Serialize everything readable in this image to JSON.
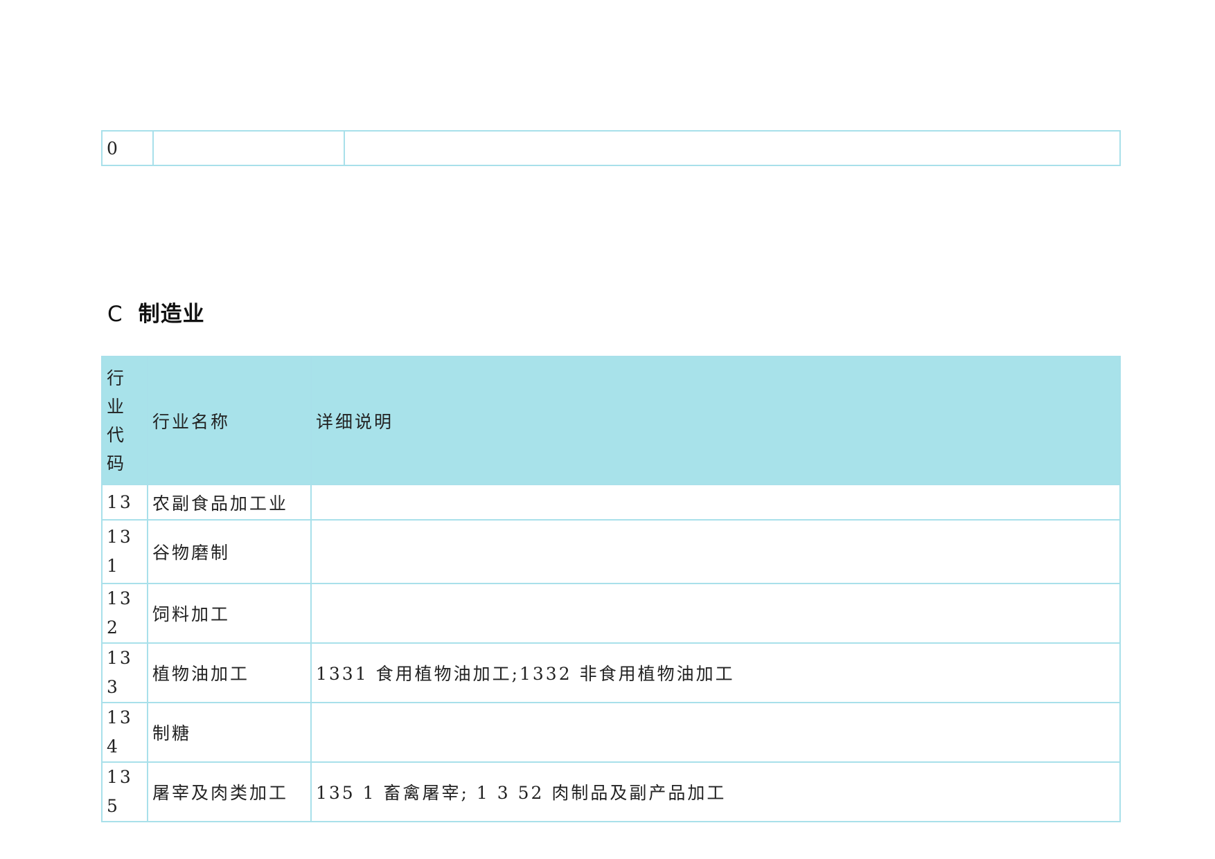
{
  "previous_table": {
    "rows": [
      {
        "code": "0",
        "name": "",
        "detail": ""
      }
    ]
  },
  "section": {
    "letter": "C",
    "title": "制造业"
  },
  "table": {
    "headers": {
      "code": [
        "行",
        "业",
        "代",
        "码"
      ],
      "name": "行业名称",
      "detail": "详细说明"
    },
    "rows": [
      {
        "code": "13",
        "name": "农副食品加工业",
        "detail": ""
      },
      {
        "code": "131",
        "name": "谷物磨制",
        "detail": ""
      },
      {
        "code": "132",
        "name": "饲料加工",
        "detail": ""
      },
      {
        "code": "133",
        "name": "植物油加工",
        "detail": "1331 食用植物油加工;1332 非食用植物油加工"
      },
      {
        "code": "134",
        "name": "制糖",
        "detail": ""
      },
      {
        "code": "135",
        "name": "屠宰及肉类加工",
        "detail": "135 1  畜禽屠宰; 1 3 52 肉制品及副产品加工"
      }
    ]
  },
  "colors": {
    "border": "#a8e0ea",
    "header_background": "#a8e2ea"
  }
}
